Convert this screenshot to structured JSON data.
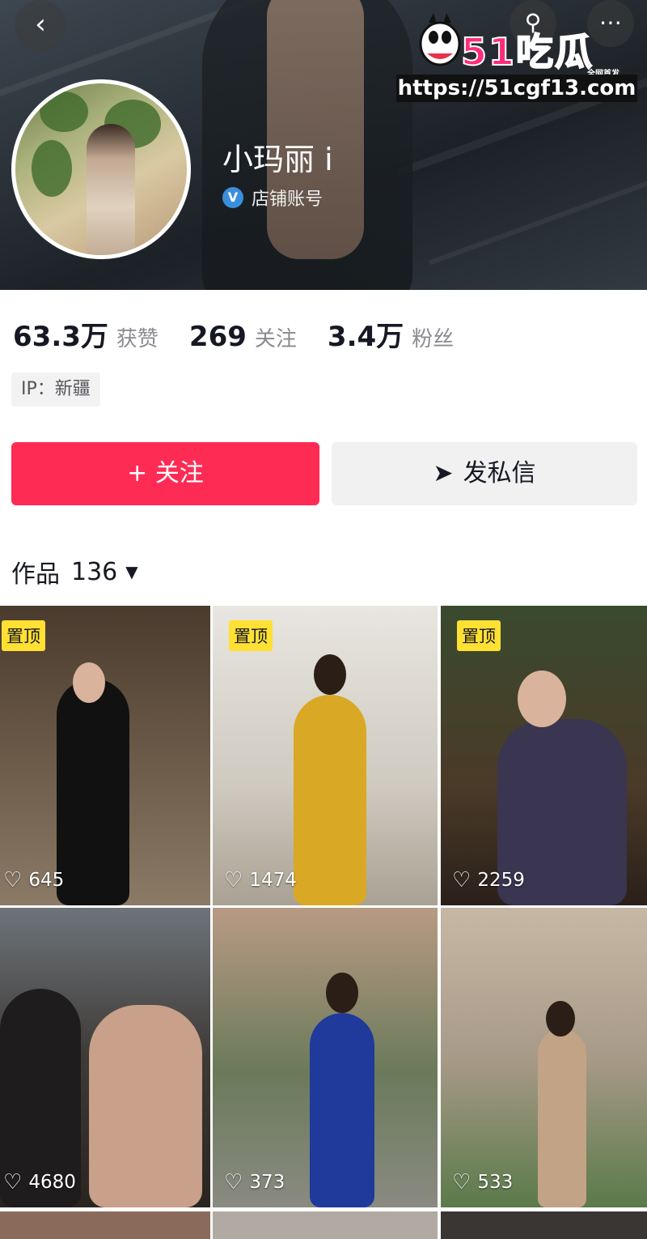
{
  "header": {
    "back_icon": "chevron-left-icon",
    "search_icon": "search-icon",
    "more_icon": "more-dots-icon",
    "nickname": "小玛丽 i",
    "account_type": "店铺账号",
    "verify_icon": "verified-badge-icon"
  },
  "watermark": {
    "brand": "51吃瓜",
    "tag": "全网首发",
    "url": "https://51cgf13.com"
  },
  "stats": [
    {
      "value": "63.3万",
      "label": "获赞"
    },
    {
      "value": "269",
      "label": "关注"
    },
    {
      "value": "3.4万",
      "label": "粉丝"
    }
  ],
  "ip_label": "IP：新疆",
  "actions": {
    "follow": "+ 关注",
    "message": "发私信"
  },
  "works": {
    "label": "作品",
    "count": "136"
  },
  "videos": [
    {
      "pinned": "置顶",
      "likes": "645",
      "theme": "#5b4a3a"
    },
    {
      "pinned": "置顶",
      "likes": "1474",
      "theme": "#d9d6cf"
    },
    {
      "pinned": "置顶",
      "likes": "2259",
      "theme": "#3d4a3a"
    },
    {
      "pinned": "",
      "likes": "4680",
      "theme": "#6b7078"
    },
    {
      "pinned": "",
      "likes": "373",
      "theme": "#8a7a6a"
    },
    {
      "pinned": "",
      "likes": "533",
      "theme": "#a89a88"
    }
  ]
}
